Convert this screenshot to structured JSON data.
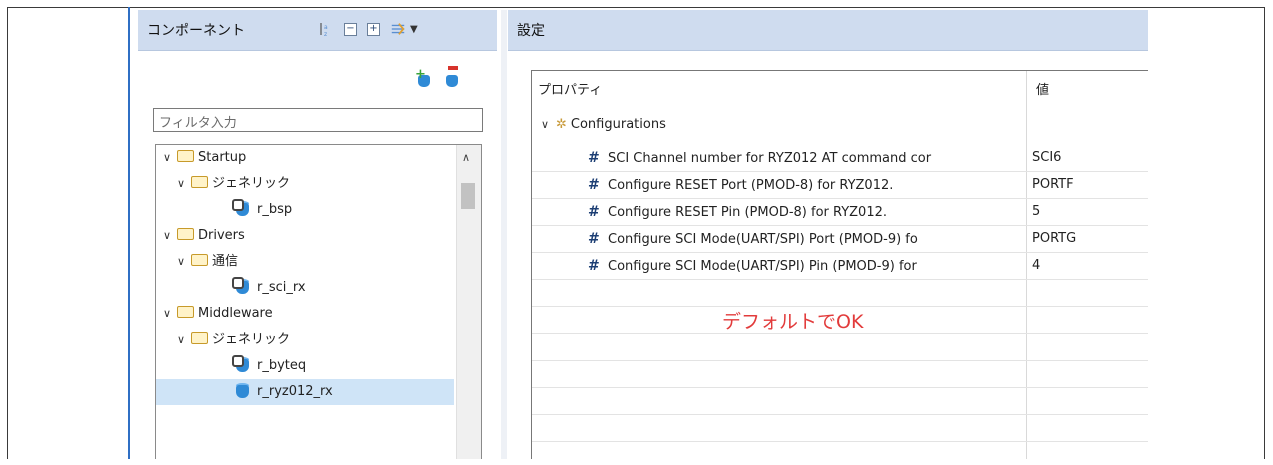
{
  "components_panel": {
    "title": "コンポーネント",
    "toolbar_icons": [
      "sort-az-icon",
      "collapse-all-icon",
      "expand-all-icon",
      "filter-settings-icon",
      "dropdown-arrow-icon"
    ],
    "filter": {
      "placeholder": "フィルタ入力",
      "value": ""
    },
    "tree": [
      {
        "label": "Startup",
        "type": "folder",
        "level": 0,
        "expanded": true
      },
      {
        "label": "ジェネリック",
        "type": "folder",
        "level": 1,
        "expanded": true
      },
      {
        "label": "r_bsp",
        "type": "component",
        "level": 2,
        "locked": true
      },
      {
        "label": "Drivers",
        "type": "folder",
        "level": 0,
        "expanded": true
      },
      {
        "label": "通信",
        "type": "folder",
        "level": 1,
        "expanded": true
      },
      {
        "label": "r_sci_rx",
        "type": "component",
        "level": 2,
        "locked": true
      },
      {
        "label": "Middleware",
        "type": "folder",
        "level": 0,
        "expanded": true
      },
      {
        "label": "ジェネリック",
        "type": "folder",
        "level": 1,
        "expanded": true
      },
      {
        "label": "r_byteq",
        "type": "component",
        "level": 2,
        "locked": true
      },
      {
        "label": "r_ryz012_rx",
        "type": "component",
        "level": 2,
        "locked": false,
        "selected": true
      }
    ]
  },
  "settings_panel": {
    "title": "設定",
    "columns": {
      "property": "プロパティ",
      "value": "値"
    },
    "group": "Configurations",
    "rows": [
      {
        "name": "SCI Channel number for RYZ012 AT command cor",
        "value": "SCI6"
      },
      {
        "name": "Configure RESET Port (PMOD-8) for RYZ012.",
        "value": "PORTF"
      },
      {
        "name": "Configure RESET Pin (PMOD-8) for RYZ012.",
        "value": "5"
      },
      {
        "name": "Configure SCI Mode(UART/SPI) Port (PMOD-9) fo",
        "value": "PORTG"
      },
      {
        "name": "Configure SCI Mode(UART/SPI) Pin (PMOD-9) for",
        "value": "4"
      }
    ],
    "annotation": "デフォルトでOK"
  },
  "colors": {
    "header_bg": "#cfdcef",
    "selection": "#cfe4f7",
    "annotation": "#e23b3b",
    "accent_strip": "#2f6fc4"
  }
}
